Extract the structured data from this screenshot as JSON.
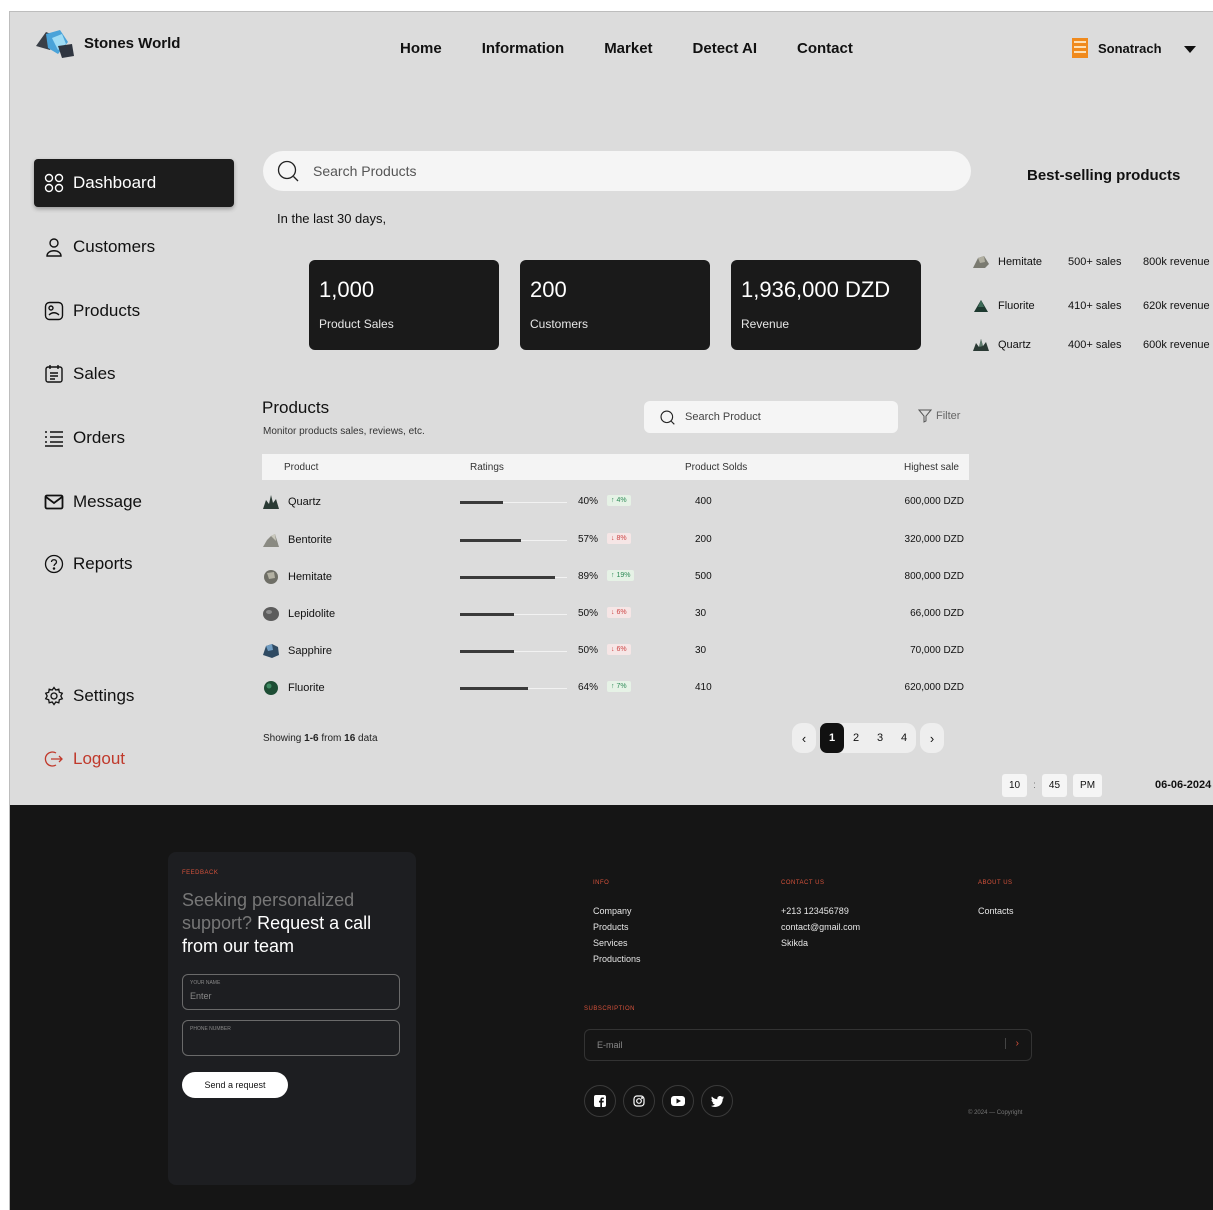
{
  "header": {
    "brand": "Stones World",
    "nav": [
      "Home",
      "Information",
      "Market",
      "Detect AI",
      "Contact"
    ],
    "user": "Sonatrach"
  },
  "sidebar": {
    "items": [
      {
        "label": "Dashboard",
        "icon": "grid-icon",
        "active": true
      },
      {
        "label": "Customers",
        "icon": "user-icon"
      },
      {
        "label": "Products",
        "icon": "product-icon"
      },
      {
        "label": "Sales",
        "icon": "receipt-icon"
      },
      {
        "label": "Orders",
        "icon": "list-icon"
      },
      {
        "label": "Message",
        "icon": "mail-icon"
      },
      {
        "label": "Reports",
        "icon": "help-icon"
      }
    ],
    "settings": "Settings",
    "logout": "Logout"
  },
  "search": {
    "placeholder": "Search Products"
  },
  "period": "In the last 30 days,",
  "stats": [
    {
      "value": "1,000",
      "label": "Product Sales"
    },
    {
      "value": "200",
      "label": "Customers"
    },
    {
      "value": "1,936,000 DZD",
      "label": "Revenue"
    }
  ],
  "best_selling": {
    "title": "Best-selling products",
    "items": [
      {
        "name": "Hemitate",
        "sales": "500+ sales",
        "revenue": "800k revenue"
      },
      {
        "name": "Fluorite",
        "sales": "410+ sales",
        "revenue": "620k revenue"
      },
      {
        "name": "Quartz",
        "sales": "400+ sales",
        "revenue": "600k revenue"
      }
    ]
  },
  "products": {
    "title": "Products",
    "subtitle": "Monitor products sales, reviews, etc.",
    "search_placeholder": "Search Product",
    "filter": "Filter",
    "columns": [
      "Product",
      "Ratings",
      "Product Solds",
      "Highest sale"
    ],
    "rows": [
      {
        "name": "Quartz",
        "rating": "40%",
        "rating_value": 40,
        "change": "↑ 4%",
        "dir": "up",
        "sold": "400",
        "highest": "600,000 DZD"
      },
      {
        "name": "Bentorite",
        "rating": "57%",
        "rating_value": 57,
        "change": "↓ 8%",
        "dir": "down",
        "sold": "200",
        "highest": "320,000 DZD"
      },
      {
        "name": "Hemitate",
        "rating": "89%",
        "rating_value": 89,
        "change": "↑ 19%",
        "dir": "up",
        "sold": "500",
        "highest": "800,000 DZD"
      },
      {
        "name": "Lepidolite",
        "rating": "50%",
        "rating_value": 50,
        "change": "↓ 6%",
        "dir": "down",
        "sold": "30",
        "highest": "66,000 DZD"
      },
      {
        "name": "Sapphire",
        "rating": "50%",
        "rating_value": 50,
        "change": "↓ 6%",
        "dir": "down",
        "sold": "30",
        "highest": "70,000 DZD"
      },
      {
        "name": "Fluorite",
        "rating": "64%",
        "rating_value": 64,
        "change": "↑ 7%",
        "dir": "up",
        "sold": "410",
        "highest": "620,000 DZD"
      }
    ],
    "showing_prefix": "Showing ",
    "showing_range": "1-6",
    "showing_mid": " from ",
    "showing_total": "16",
    "showing_suffix": " data",
    "pages": [
      "1",
      "2",
      "3",
      "4"
    ]
  },
  "time": {
    "hour": "10",
    "minute": "45",
    "ampm": "PM",
    "date": "06-06-2024"
  },
  "footer": {
    "feedback_label": "FEEDBACK",
    "heading_muted": "Seeking personalized support?",
    "heading_bright": " Request a call from our team",
    "name_label": "YOUR NAME",
    "name_placeholder": "Enter",
    "phone_label": "PHONE NUMBER",
    "button": "Send a request",
    "info_label": "INFO",
    "info_links": [
      "Company",
      "Products",
      "Services",
      "Productions"
    ],
    "contact_label": "CONTACT US",
    "contact_lines": [
      "+213 123456789",
      "contact@gmail.com",
      "Skikda"
    ],
    "about_label": "ABOUT US",
    "about_links": [
      "Contacts"
    ],
    "subscription_label": "SUBSCRIPTION",
    "email_placeholder": "E-mail",
    "copyright": "© 2024 — Copyright"
  }
}
